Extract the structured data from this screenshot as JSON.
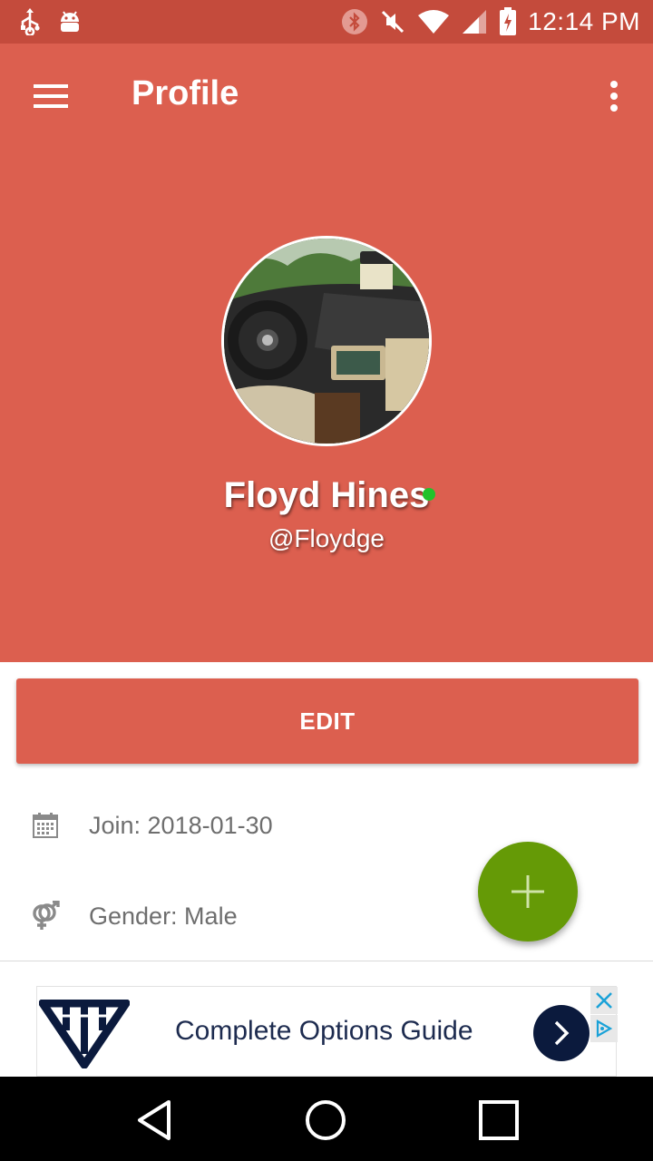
{
  "status_bar": {
    "time": "12:14 PM",
    "icons": [
      "usb-icon",
      "android-debug-icon",
      "bluetooth-icon",
      "mute-icon",
      "wifi-icon",
      "signal-icon",
      "battery-charging-icon"
    ]
  },
  "app_bar": {
    "title": "Profile",
    "menu_icon": "hamburger-menu-icon",
    "overflow_icon": "more-vert-icon"
  },
  "profile": {
    "name": "Floyd Hines",
    "handle": "@Floydge",
    "online": true,
    "online_color": "#22c22a",
    "avatar_alt": "car interior photo"
  },
  "edit_button": {
    "label": "EDIT"
  },
  "info": {
    "join": "Join: 2018-01-30",
    "gender": "Gender: Male",
    "join_icon": "calendar-icon",
    "gender_icon": "gender-icon"
  },
  "fab": {
    "icon": "plus-icon",
    "color": "#659a06"
  },
  "ad": {
    "title": "Complete Options Guide",
    "logo_icon": "diamond-logo-icon",
    "go_icon": "chevron-right-icon",
    "close_icon": "close-icon",
    "adchoices_icon": "adchoices-icon"
  },
  "colors": {
    "primary": "#dc5f4f",
    "status_bar": "#c44b3c",
    "accent": "#659a06"
  },
  "nav_bar": {
    "icons": [
      "back-icon",
      "home-icon",
      "recents-icon"
    ]
  }
}
